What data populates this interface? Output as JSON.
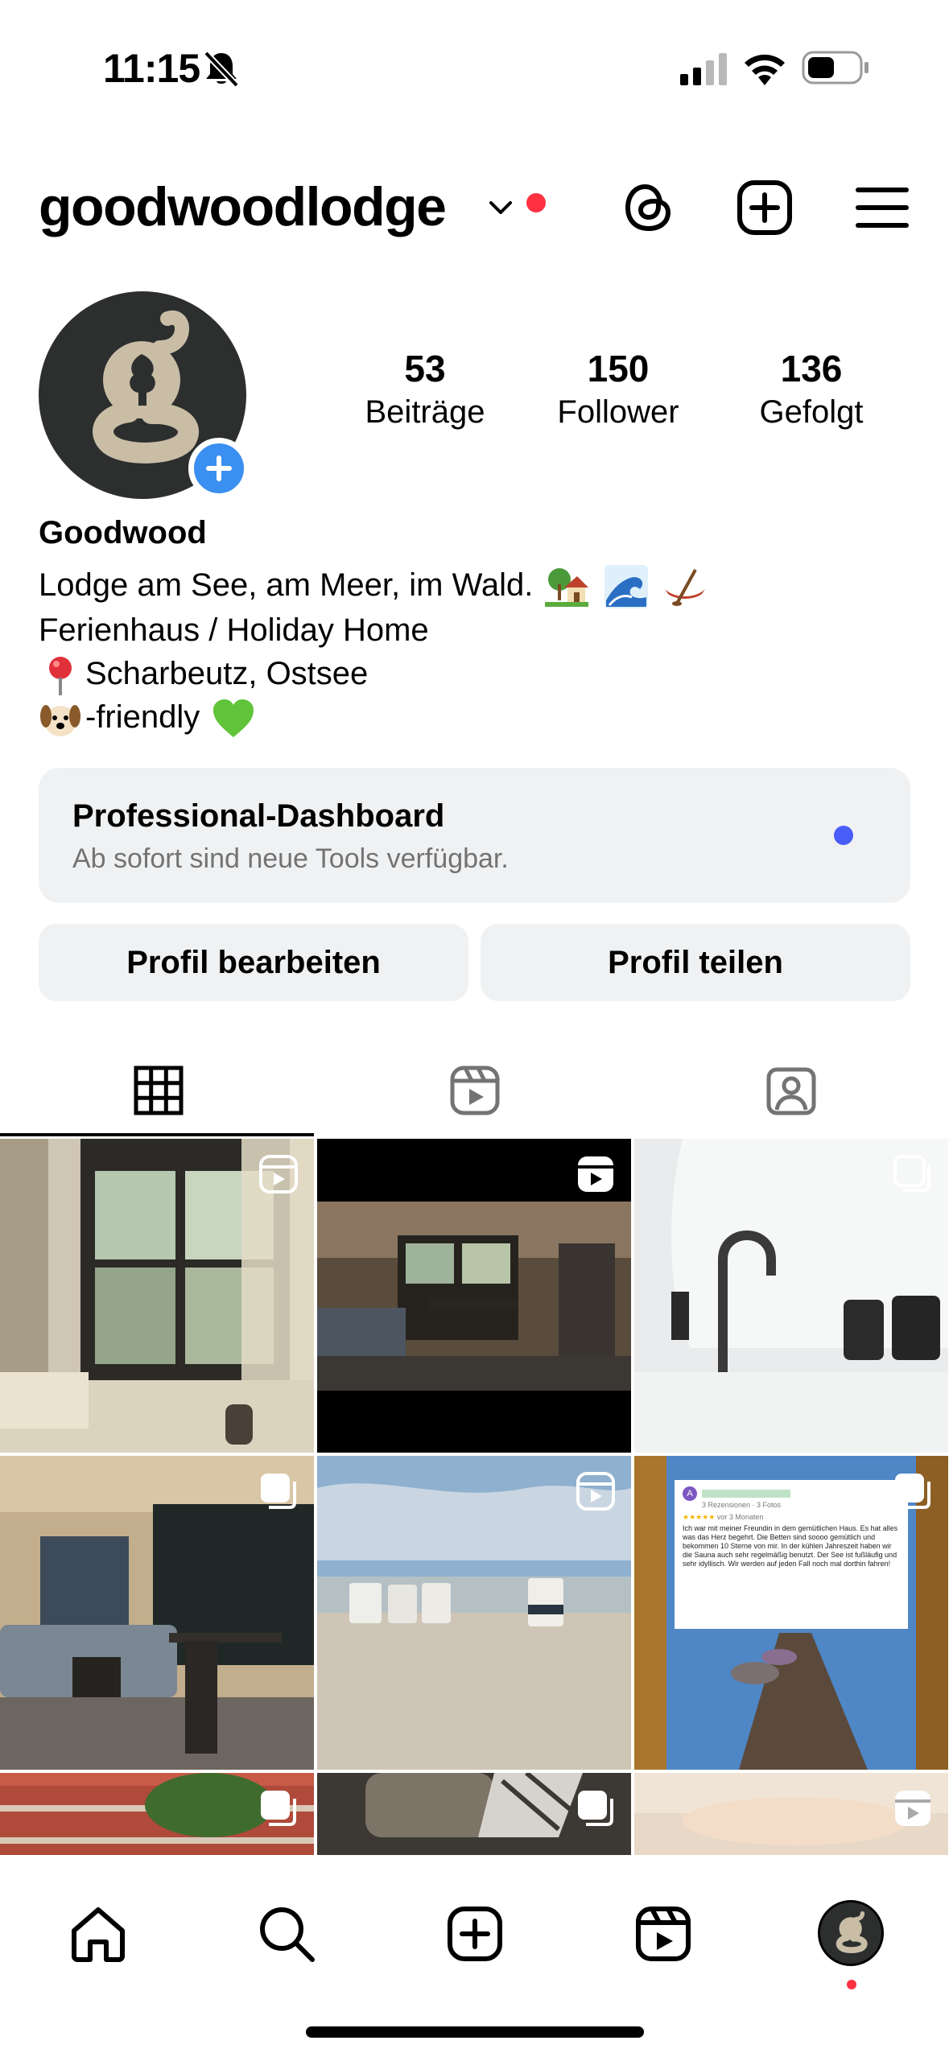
{
  "status_bar": {
    "time": "11:15"
  },
  "header": {
    "username": "goodwoodlodge"
  },
  "stats": {
    "posts": {
      "count": "53",
      "label": "Beiträge"
    },
    "followers": {
      "count": "150",
      "label": "Follower"
    },
    "following": {
      "count": "136",
      "label": "Gefolgt"
    }
  },
  "bio": {
    "name": "Goodwood",
    "line1": "Lodge am See, am Meer, im Wald.",
    "line2": "Ferienhaus / Holiday Home",
    "line3": "Scharbeutz, Ostsee",
    "line4": "-friendly"
  },
  "dashboard": {
    "title": "Professional-Dashboard",
    "subtitle": "Ab sofort sind neue Tools verfügbar."
  },
  "buttons": {
    "edit": "Profil bearbeiten",
    "share": "Profil teilen"
  },
  "tabs": [
    "grid-icon",
    "reels-icon",
    "tagged-icon"
  ],
  "review_card": {
    "reviewer_initial": "A",
    "meta": "3 Rezensionen · 3 Fotos",
    "stars": "★★★★★",
    "age": "vor 3 Monaten",
    "text": "Ich war mit meiner Freundin in dem gemütlichen Haus. Es hat alles was das Herz begehrt. Die Betten sind soooo gemütlich und bekommen 10 Sterne von mir. In der kühlen Jahreszeit haben wir die Sauna auch sehr regelmäßig benutzt. Der See ist fußläufig und sehr idyllisch. Wir werden auf jeden Fall noch mal dorthin fahren!"
  },
  "colors": {
    "accent_blue": "#3b8ff0",
    "notification_red": "#ff3040",
    "dashboard_dot": "#4a5df9",
    "brand_dark": "#2c2f2e",
    "brand_tan": "#c9bda6"
  }
}
